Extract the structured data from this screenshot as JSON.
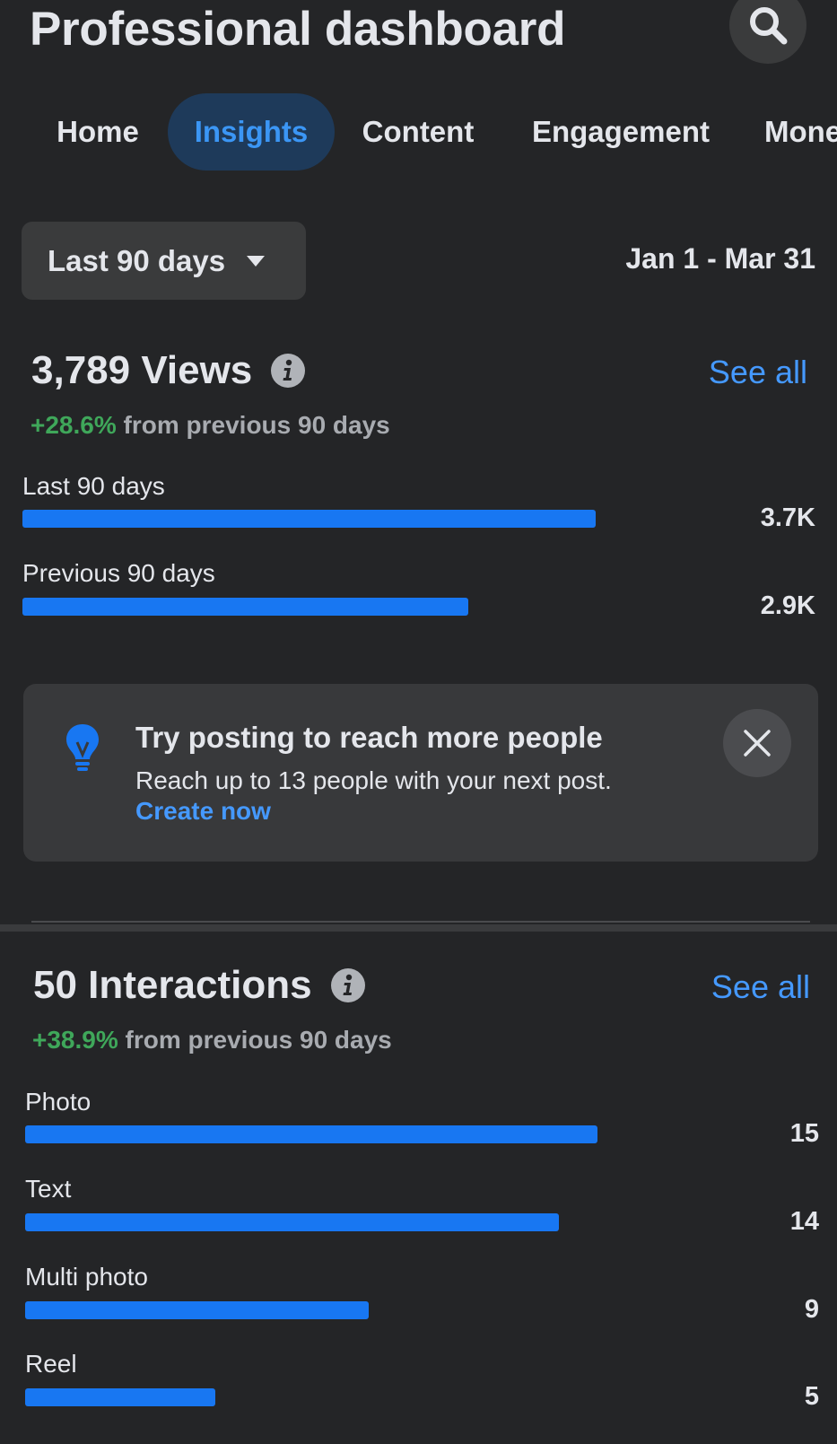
{
  "header": {
    "title": "Professional dashboard",
    "search_icon": "search-icon"
  },
  "tabs": [
    {
      "label": "Home",
      "active": false
    },
    {
      "label": "Insights",
      "active": true
    },
    {
      "label": "Content",
      "active": false
    },
    {
      "label": "Engagement",
      "active": false
    },
    {
      "label": "Mone",
      "active": false
    }
  ],
  "period": {
    "selected": "Last 90 days",
    "date_range": "Jan 1 - Mar 31"
  },
  "views": {
    "title": "3,789 Views",
    "see_all": "See all",
    "change": "+28.6%",
    "change_text": " from previous 90 days",
    "rows": [
      {
        "label": "Last 90 days",
        "value": "3.7K",
        "fraction": 1.0
      },
      {
        "label": "Previous 90 days",
        "value": "2.9K",
        "fraction": 0.778
      }
    ]
  },
  "tip": {
    "title": "Try posting to reach more people",
    "body": "Reach up to 13 people with your next post.",
    "cta": "Create now",
    "icon": "lightbulb-icon",
    "close_icon": "close-icon"
  },
  "interactions": {
    "title": "50 Interactions",
    "see_all": "See all",
    "change": "+38.9%",
    "change_text": " from previous 90 days",
    "rows": [
      {
        "label": "Photo",
        "value": "15",
        "fraction": 1.0
      },
      {
        "label": "Text",
        "value": "14",
        "fraction": 0.933
      },
      {
        "label": "Multi photo",
        "value": "9",
        "fraction": 0.6
      },
      {
        "label": "Reel",
        "value": "5",
        "fraction": 0.333
      }
    ]
  },
  "colors": {
    "background": "#242527",
    "accent": "#1877f2",
    "link": "#4599ff",
    "positive": "#3fa75a",
    "active_tab_bg": "#1e3a5a"
  }
}
